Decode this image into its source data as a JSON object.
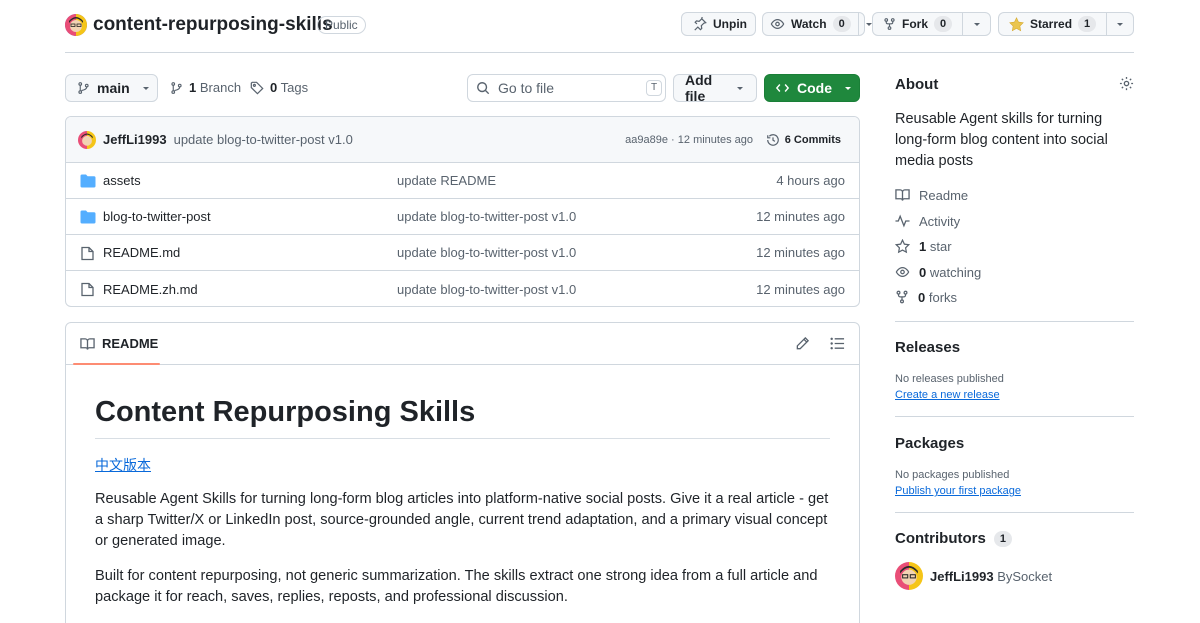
{
  "repo": {
    "name": "content-repurposing-skills",
    "visibility": "Public"
  },
  "actions": {
    "unpin": "Unpin",
    "watch": {
      "label": "Watch",
      "count": "0"
    },
    "fork": {
      "label": "Fork",
      "count": "0"
    },
    "starred": {
      "label": "Starred",
      "count": "1"
    }
  },
  "toolbar": {
    "branch": "main",
    "branches": {
      "count": "1",
      "label": "Branch"
    },
    "tags": {
      "count": "0",
      "label": "Tags"
    },
    "search_placeholder": "Go to file",
    "search_shortcut": "T",
    "add_file": "Add file",
    "code": "Code"
  },
  "commit": {
    "author": "JeffLi1993",
    "message": "update blog-to-twitter-post v1.0",
    "meta": "aa9a89e · 12 minutes ago",
    "commits": "6 Commits"
  },
  "files": [
    {
      "type": "folder",
      "name": "assets",
      "message": "update README",
      "date": "4 hours ago"
    },
    {
      "type": "folder",
      "name": "blog-to-twitter-post",
      "message": "update blog-to-twitter-post v1.0",
      "date": "12 minutes ago"
    },
    {
      "type": "file",
      "name": "README.md",
      "message": "update blog-to-twitter-post v1.0",
      "date": "12 minutes ago"
    },
    {
      "type": "file",
      "name": "README.zh.md",
      "message": "update blog-to-twitter-post v1.0",
      "date": "12 minutes ago"
    }
  ],
  "readme": {
    "tab": "README",
    "title": "Content Repurposing Skills",
    "link": "中文版本",
    "para1": "Reusable Agent Skills for turning long-form blog articles into platform-native social posts. Give it a real article - get a sharp Twitter/X or LinkedIn post, source-grounded angle, current trend adaptation, and a primary visual concept or generated image.",
    "para2": "Built for content repurposing, not generic summarization. The skills extract one strong idea from a full article and package it for reach, saves, replies, reposts, and professional discussion."
  },
  "about": {
    "heading": "About",
    "description": "Reusable Agent skills for turning long-form blog content into social media posts",
    "readme": "Readme",
    "activity": "Activity",
    "stars": {
      "count": "1",
      "label": "star"
    },
    "watching": {
      "count": "0",
      "label": "watching"
    },
    "forks": {
      "count": "0",
      "label": "forks"
    }
  },
  "releases": {
    "heading": "Releases",
    "empty": "No releases published",
    "link": "Create a new release"
  },
  "packages": {
    "heading": "Packages",
    "empty": "No packages published",
    "link": "Publish your first package"
  },
  "contributors": {
    "heading": "Contributors",
    "count": "1",
    "user": "JeffLi1993",
    "suffix": "BySocket"
  },
  "colors": {
    "accent": "#0969da",
    "code_button": "#1f883d",
    "border": "#d0d7de",
    "folder": "#54aeff",
    "star": "#eac54f",
    "tab_underline": "#fd8c73"
  }
}
